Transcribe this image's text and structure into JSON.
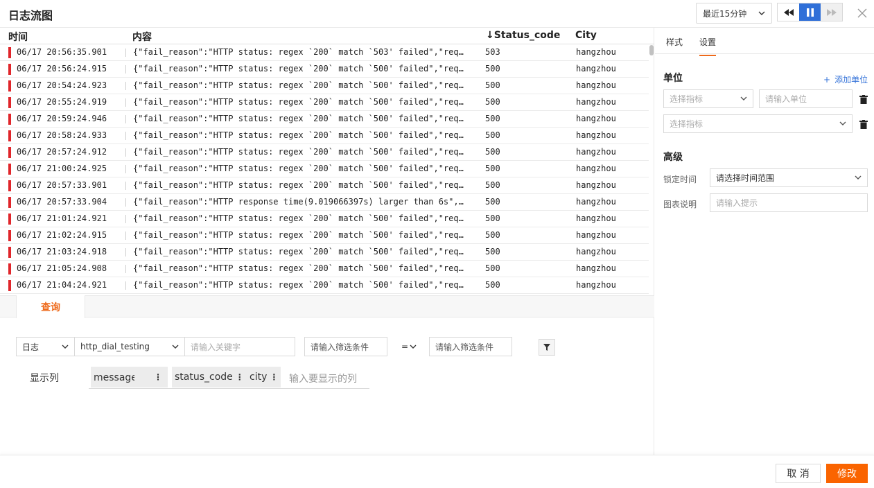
{
  "header": {
    "title": "日志流图",
    "time_range": "最近15分钟",
    "colors": {
      "accent": "#2f6fd8",
      "brand": "#fa6400",
      "error": "#e0262b"
    }
  },
  "table": {
    "columns": {
      "time": "时间",
      "content": "内容",
      "status": "Status_code",
      "status_sort": "↓",
      "city": "City"
    },
    "rows": [
      {
        "time": "06/17 20:56:35.901",
        "content": "{\"fail_reason\":\"HTTP status: regex `200` match `503' failed\",\"req…",
        "status": "503",
        "city": "hangzhou"
      },
      {
        "time": "06/17 20:56:24.915",
        "content": "{\"fail_reason\":\"HTTP status: regex `200` match `500' failed\",\"req…",
        "status": "500",
        "city": "hangzhou"
      },
      {
        "time": "06/17 20:54:24.923",
        "content": "{\"fail_reason\":\"HTTP status: regex `200` match `500' failed\",\"req…",
        "status": "500",
        "city": "hangzhou"
      },
      {
        "time": "06/17 20:55:24.919",
        "content": "{\"fail_reason\":\"HTTP status: regex `200` match `500' failed\",\"req…",
        "status": "500",
        "city": "hangzhou"
      },
      {
        "time": "06/17 20:59:24.946",
        "content": "{\"fail_reason\":\"HTTP status: regex `200` match `500' failed\",\"req…",
        "status": "500",
        "city": "hangzhou"
      },
      {
        "time": "06/17 20:58:24.933",
        "content": "{\"fail_reason\":\"HTTP status: regex `200` match `500' failed\",\"req…",
        "status": "500",
        "city": "hangzhou"
      },
      {
        "time": "06/17 20:57:24.912",
        "content": "{\"fail_reason\":\"HTTP status: regex `200` match `500' failed\",\"req…",
        "status": "500",
        "city": "hangzhou"
      },
      {
        "time": "06/17 21:00:24.925",
        "content": "{\"fail_reason\":\"HTTP status: regex `200` match `500' failed\",\"req…",
        "status": "500",
        "city": "hangzhou"
      },
      {
        "time": "06/17 20:57:33.901",
        "content": "{\"fail_reason\":\"HTTP status: regex `200` match `500' failed\",\"req…",
        "status": "500",
        "city": "hangzhou"
      },
      {
        "time": "06/17 20:57:33.904",
        "content": "{\"fail_reason\":\"HTTP response time(9.019066397s) larger than 6s\",…",
        "status": "500",
        "city": "hangzhou"
      },
      {
        "time": "06/17 21:01:24.921",
        "content": "{\"fail_reason\":\"HTTP status: regex `200` match `500' failed\",\"req…",
        "status": "500",
        "city": "hangzhou"
      },
      {
        "time": "06/17 21:02:24.915",
        "content": "{\"fail_reason\":\"HTTP status: regex `200` match `500' failed\",\"req…",
        "status": "500",
        "city": "hangzhou"
      },
      {
        "time": "06/17 21:03:24.918",
        "content": "{\"fail_reason\":\"HTTP status: regex `200` match `500' failed\",\"req…",
        "status": "500",
        "city": "hangzhou"
      },
      {
        "time": "06/17 21:05:24.908",
        "content": "{\"fail_reason\":\"HTTP status: regex `200` match `500' failed\",\"req…",
        "status": "500",
        "city": "hangzhou"
      },
      {
        "time": "06/17 21:04:24.921",
        "content": "{\"fail_reason\":\"HTTP status: regex `200` match `500' failed\",\"req…",
        "status": "500",
        "city": "hangzhou"
      }
    ]
  },
  "query": {
    "tab_label": "查询",
    "source_type": "日志",
    "index": "http_dial_testing",
    "keyword_placeholder": "请输入关键字",
    "filter_field_placeholder": "请输入筛选条件",
    "operator": "=",
    "filter_value_placeholder": "请输入筛选条件",
    "columns_label": "显示列",
    "columns": [
      "message内容",
      "status_code",
      "city"
    ],
    "columns_placeholder": "输入要显示的列"
  },
  "settings": {
    "tabs": [
      "样式",
      "设置"
    ],
    "unit_title": "单位",
    "add_unit": "添加单位",
    "metric_placeholder": "选择指标",
    "unit_placeholder": "请输入单位",
    "advanced_title": "高级",
    "lock_time_label": "锁定时间",
    "lock_time_value": "请选择时间范围",
    "desc_label": "图表说明",
    "desc_placeholder": "请输入提示"
  },
  "footer": {
    "cancel": "取 消",
    "confirm": "修改"
  }
}
